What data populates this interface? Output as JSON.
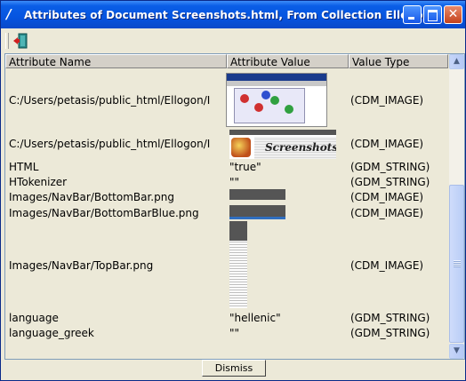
{
  "window": {
    "title": "Attributes of Document Screenshots.html, From Collection Ellogon",
    "title_icon": "feather-pen-icon"
  },
  "toolbar": {
    "exit_icon": "exit-door-icon"
  },
  "table": {
    "headers": [
      "Attribute Name",
      "Attribute Value",
      "Value Type"
    ],
    "rows": [
      {
        "name": "C:/Users/petasis/public_html/Ellogon/I",
        "value": "",
        "type": "(CDM_IMAGE)"
      },
      {
        "name": "C:/Users/petasis/public_html/Ellogon/I",
        "value": "",
        "type": "(CDM_IMAGE)"
      },
      {
        "name": "HTML",
        "value": "\"true\"",
        "type": "(GDM_STRING)"
      },
      {
        "name": "HTokenizer",
        "value": "\"\"",
        "type": "(GDM_STRING)"
      },
      {
        "name": "Images/NavBar/BottomBar.png",
        "value": "",
        "type": "(CDM_IMAGE)"
      },
      {
        "name": "Images/NavBar/BottomBarBlue.png",
        "value": "",
        "type": "(CDM_IMAGE)"
      },
      {
        "name": "Images/NavBar/TopBar.png",
        "value": "",
        "type": "(CDM_IMAGE)"
      },
      {
        "name": "language",
        "value": "\"hellenic\"",
        "type": "(GDM_STRING)"
      },
      {
        "name": "language_greek",
        "value": "\"\"",
        "type": "(GDM_STRING)"
      }
    ],
    "image_caption": "Screenshots"
  },
  "footer": {
    "dismiss_label": "Dismiss"
  },
  "colors": {
    "titlebar": "#0554e0",
    "face": "#ece9d8",
    "header": "#d4d0c8"
  }
}
